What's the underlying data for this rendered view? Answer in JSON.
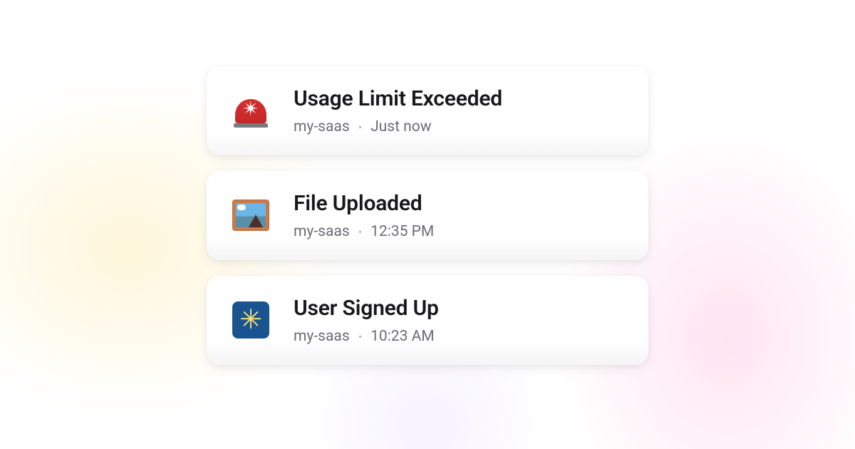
{
  "notifications": [
    {
      "icon": "siren",
      "title": "Usage Limit Exceeded",
      "source": "my-saas",
      "time": "Just now"
    },
    {
      "icon": "picture",
      "title": "File Uploaded",
      "source": "my-saas",
      "time": "12:35 PM"
    },
    {
      "icon": "burst",
      "title": "User Signed Up",
      "source": "my-saas",
      "time": "10:23 AM"
    }
  ]
}
